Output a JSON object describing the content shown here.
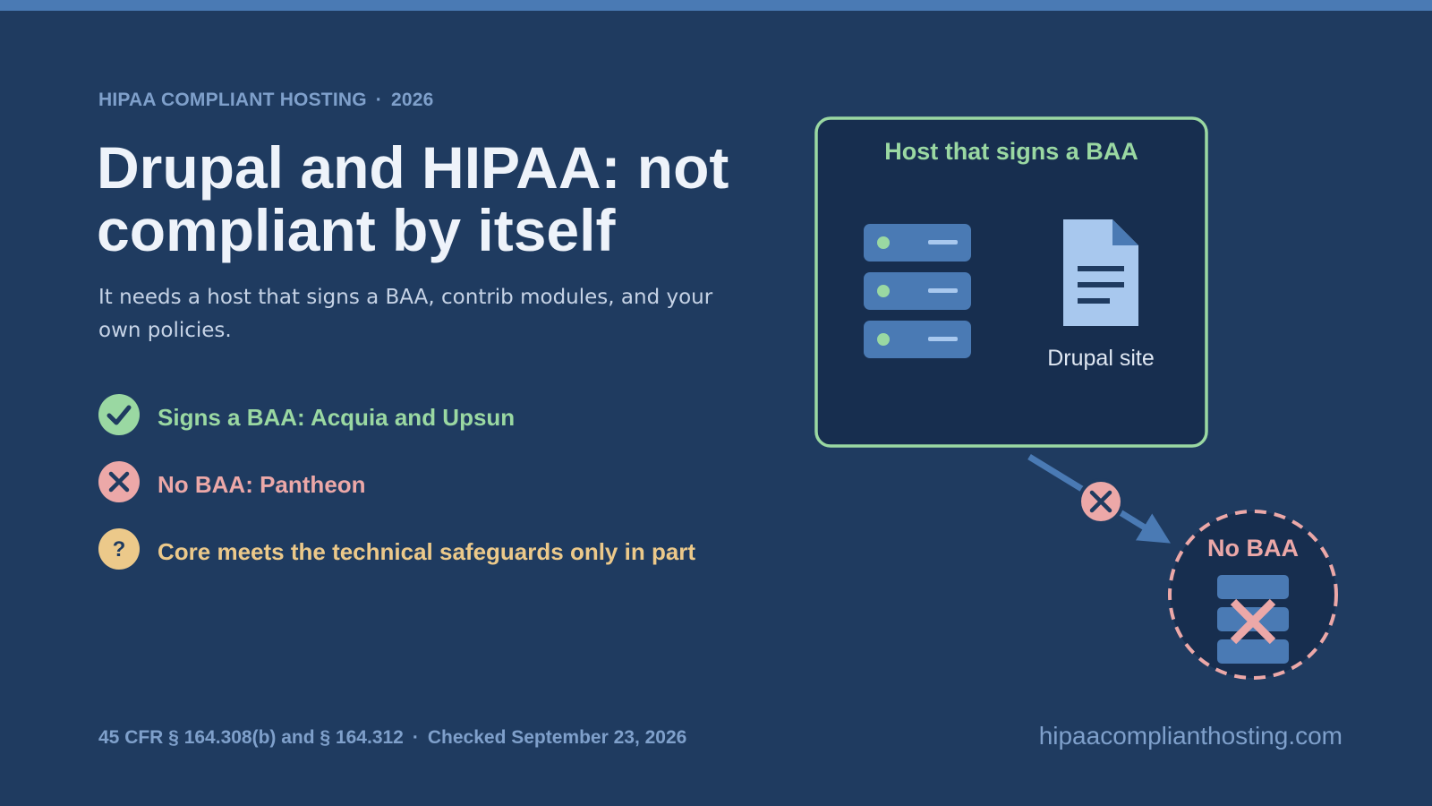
{
  "header": {
    "eyebrow_brand": "HIPAA COMPLIANT HOSTING",
    "eyebrow_separator": "·",
    "eyebrow_year": "2026",
    "title": "Drupal and HIPAA: not compliant by itself",
    "subtitle": "It needs a host that signs a BAA, contrib modules, and your own policies."
  },
  "checklist": [
    {
      "status": "yes",
      "icon": "checkmark-icon",
      "label": "Signs a BAA: Acquia and Upsun",
      "color": "#9ad8a2"
    },
    {
      "status": "no",
      "icon": "x-icon",
      "label": "No BAA: Pantheon",
      "color": "#eca8a8"
    },
    {
      "status": "partial",
      "icon": "question-icon",
      "label": "Core meets the technical safeguards only in part",
      "color": "#ecc98a"
    }
  ],
  "diagram": {
    "baa_host_label": "Host that signs a BAA",
    "site_label": "Drupal site",
    "no_baa_label": "No BAA",
    "colors": {
      "baa_border": "#9ad8a2",
      "no_baa_border": "#eca8a8",
      "panel_fill": "#172e4f",
      "server_fill": "#4a7ab4",
      "document_fill": "#a8c8ee"
    }
  },
  "footer": {
    "citation": "45 CFR § 164.308(b) and § 164.312",
    "separator": "·",
    "checked": "Checked September 23, 2026",
    "site": "hipaacomplianthosting.com"
  }
}
